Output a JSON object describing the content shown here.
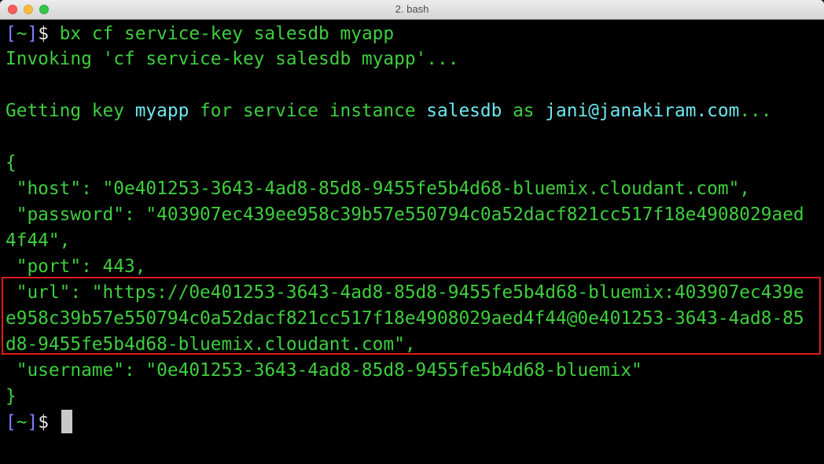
{
  "window": {
    "title": "2. bash"
  },
  "prompt": {
    "open": "[",
    "dir": "~",
    "close": "]",
    "symbol": "$"
  },
  "commands": {
    "cmd1": " bx cf service-key salesdb myapp",
    "invoking": "Invoking 'cf service-key salesdb myapp'..."
  },
  "getting": {
    "p1": "Getting key ",
    "key": "myapp",
    "p2": " for service instance ",
    "service": "salesdb",
    "p3": " as ",
    "user": "jani@janakiram.com",
    "p4": "..."
  },
  "json": {
    "open": "{",
    "host": " \"host\": \"0e401253-3643-4ad8-85d8-9455fe5b4d68-bluemix.cloudant.com\",",
    "password1": " \"password\": \"403907ec439ee958c39b57e550794c0a52dacf821cc517f18e4908029aed",
    "password2": "4f44\",",
    "port": " \"port\": 443,",
    "url1": " \"url\": \"https://0e401253-3643-4ad8-85d8-9455fe5b4d68-bluemix:403907ec439e",
    "url2": "e958c39b57e550794c0a52dacf821cc517f18e4908029aed4f44@0e401253-3643-4ad8-85",
    "url3": "d8-9455fe5b4d68-bluemix.cloudant.com\",",
    "username": " \"username\": \"0e401253-3643-4ad8-85d8-9455fe5b4d68-bluemix\"",
    "close": "}"
  },
  "colors": {
    "green": "#3fce3f",
    "cyan": "#6ee7ee",
    "bracket": "#7f7fff",
    "highlight_box": "#e11b1b"
  }
}
